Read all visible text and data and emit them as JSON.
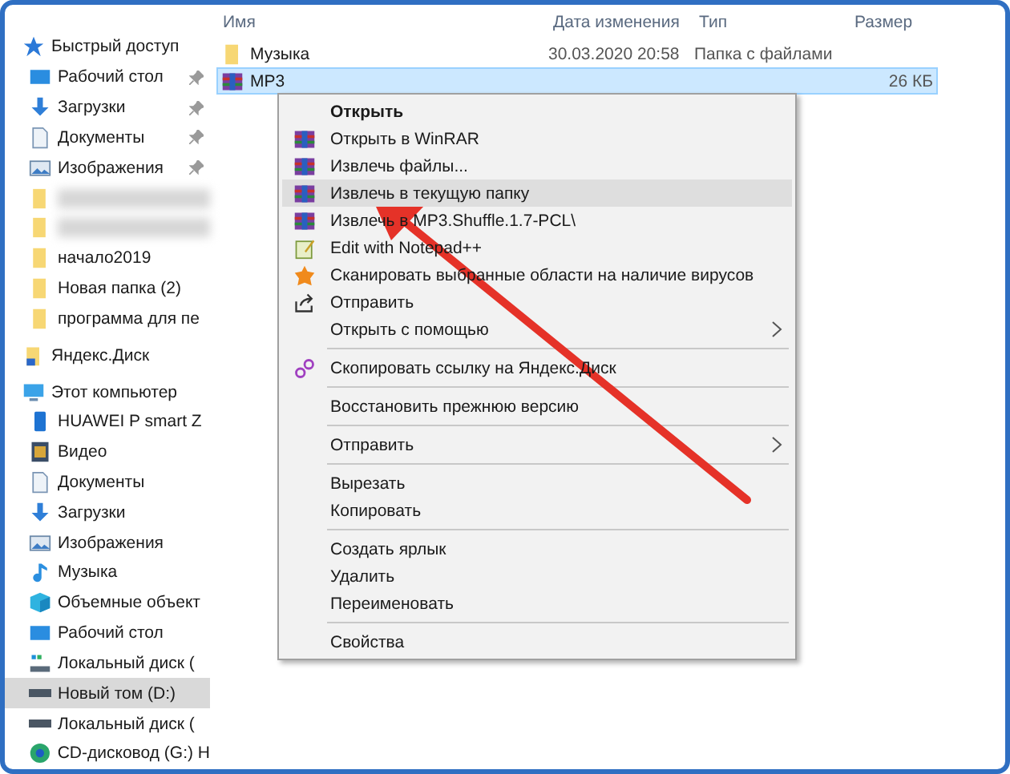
{
  "sidebar": {
    "items": [
      {
        "label": "Быстрый доступ",
        "kind": "star",
        "selected": false,
        "children": [
          {
            "label": "Рабочий стол",
            "kind": "desktop",
            "pinned": true,
            "selected": false
          },
          {
            "label": "Загрузки",
            "kind": "download",
            "pinned": true,
            "selected": false
          },
          {
            "label": "Документы",
            "kind": "document",
            "pinned": true,
            "selected": false
          },
          {
            "label": "Изображения",
            "kind": "image",
            "pinned": true,
            "selected": false
          },
          {
            "kind": "folder",
            "pinned": false,
            "selected": false
          },
          {
            "kind": "folder",
            "pinned": false,
            "selected": false
          },
          {
            "label": "начало2019",
            "kind": "folder",
            "pinned": false,
            "selected": false
          },
          {
            "label": "Новая папка (2)",
            "kind": "folder",
            "pinned": false,
            "selected": false
          },
          {
            "label": "программа для пе",
            "kind": "folder",
            "pinned": false,
            "selected": false
          }
        ]
      },
      {
        "label": "Яндекс.Диск",
        "kind": "cloud",
        "selected": false
      },
      {
        "label": "Этот компьютер",
        "kind": "computer",
        "selected": false,
        "children": [
          {
            "label": "HUAWEI P smart Z",
            "kind": "phone",
            "selected": false
          },
          {
            "label": "Видео",
            "kind": "video",
            "selected": false
          },
          {
            "label": "Документы",
            "kind": "document",
            "selected": false
          },
          {
            "label": "Загрузки",
            "kind": "download",
            "selected": false
          },
          {
            "label": "Изображения",
            "kind": "image",
            "selected": false
          },
          {
            "label": "Музыка",
            "kind": "music",
            "selected": false
          },
          {
            "label": "Объемные объект",
            "kind": "cube",
            "selected": false
          },
          {
            "label": "Рабочий стол",
            "kind": "desktop",
            "selected": false
          },
          {
            "label": "Локальный диск (",
            "kind": "system-drive",
            "selected": false
          },
          {
            "label": "Новый том (D:)",
            "kind": "drive",
            "selected": true
          },
          {
            "label": "Локальный диск (",
            "kind": "drive",
            "selected": false
          },
          {
            "label": "CD-дисковод (G:) H",
            "kind": "cd",
            "selected": false
          }
        ]
      }
    ]
  },
  "file_list": {
    "columns": [
      "Имя",
      "Дата изменения",
      "Тип",
      "Размер"
    ],
    "rows": [
      {
        "kind": "folder",
        "name": "Музыка",
        "date": "30.03.2020 20:58",
        "type": "Папка с файлами",
        "selected": false
      },
      {
        "kind": "archive",
        "name": "MP3",
        "size": "26 КБ",
        "selected": true
      }
    ]
  },
  "context_menu": {
    "items": [
      {
        "kind": "plain",
        "label": "Открыть",
        "default": true,
        "selected": false
      },
      {
        "kind": "archive",
        "label": "Открыть в WinRAR",
        "selected": false
      },
      {
        "kind": "archive",
        "label": "Извлечь файлы...",
        "selected": false
      },
      {
        "kind": "archive",
        "label": "Извлечь в текущую папку",
        "selected": true
      },
      {
        "kind": "archive",
        "label": "Извлечь в MP3.Shuffle.1.7-PCL\\",
        "selected": false
      },
      {
        "kind": "notepad",
        "label": "Edit with Notepad++",
        "selected": false
      },
      {
        "kind": "antivirus",
        "label": "Сканировать выбранные области на наличие вирусов",
        "selected": false
      },
      {
        "kind": "share",
        "label": "Отправить",
        "selected": false
      },
      {
        "kind": "plain",
        "label": "Открыть с помощью",
        "submenu": true,
        "selected": false
      },
      {
        "kind": "separator"
      },
      {
        "kind": "link",
        "label": "Скопировать ссылку на Яндекс.Диск",
        "selected": false
      },
      {
        "kind": "separator"
      },
      {
        "kind": "plain",
        "label": "Восстановить прежнюю версию",
        "selected": false
      },
      {
        "kind": "separator"
      },
      {
        "kind": "plain",
        "label": "Отправить",
        "submenu": true,
        "selected": false
      },
      {
        "kind": "separator"
      },
      {
        "kind": "plain",
        "label": "Вырезать",
        "selected": false
      },
      {
        "kind": "plain",
        "label": "Копировать",
        "selected": false
      },
      {
        "kind": "separator"
      },
      {
        "kind": "plain",
        "label": "Создать ярлык",
        "selected": false
      },
      {
        "kind": "plain",
        "label": "Удалить",
        "selected": false
      },
      {
        "kind": "plain",
        "label": "Переименовать",
        "selected": false
      },
      {
        "kind": "separator"
      },
      {
        "kind": "plain",
        "label": "Свойства",
        "selected": false
      }
    ]
  }
}
